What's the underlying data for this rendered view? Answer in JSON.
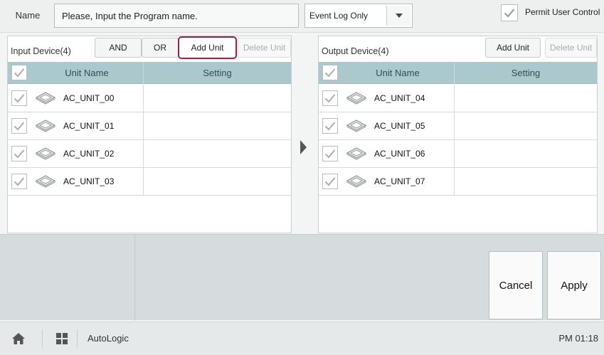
{
  "header": {
    "name_label": "Name",
    "name_value": "Please, Input the Program name.",
    "mode_select": "Event Log Only",
    "permit_label": "Permit User Control",
    "permit_checked": true
  },
  "input_panel": {
    "title": "Input Device(4)",
    "and_label": "AND",
    "or_label": "OR",
    "add_label": "Add Unit",
    "delete_label": "Delete Unit",
    "col_name": "Unit Name",
    "col_setting": "Setting",
    "units": [
      {
        "name": "AC_UNIT_00",
        "setting": ""
      },
      {
        "name": "AC_UNIT_01",
        "setting": ""
      },
      {
        "name": "AC_UNIT_02",
        "setting": ""
      },
      {
        "name": "AC_UNIT_03",
        "setting": ""
      }
    ]
  },
  "output_panel": {
    "title": "Output Device(4)",
    "add_label": "Add Unit",
    "delete_label": "Delete Unit",
    "col_name": "Unit Name",
    "col_setting": "Setting",
    "units": [
      {
        "name": "AC_UNIT_04",
        "setting": ""
      },
      {
        "name": "AC_UNIT_05",
        "setting": ""
      },
      {
        "name": "AC_UNIT_06",
        "setting": ""
      },
      {
        "name": "AC_UNIT_07",
        "setting": ""
      }
    ]
  },
  "actions": {
    "cancel_label": "Cancel",
    "apply_label": "Apply"
  },
  "statusbar": {
    "app_name": "AutoLogic",
    "time": "PM 01:18"
  },
  "icons": {
    "home": "home-icon",
    "menu": "grid-menu-icon",
    "check": "checkmark-icon",
    "unit": "ceiling-cassette-icon",
    "dropdown": "dropdown-arrow-icon",
    "transfer": "right-arrow-icon"
  },
  "colors": {
    "table_header": "#abc8cc",
    "highlight_border": "#a51d4a",
    "bottom_panel": "#d6dcdd"
  }
}
